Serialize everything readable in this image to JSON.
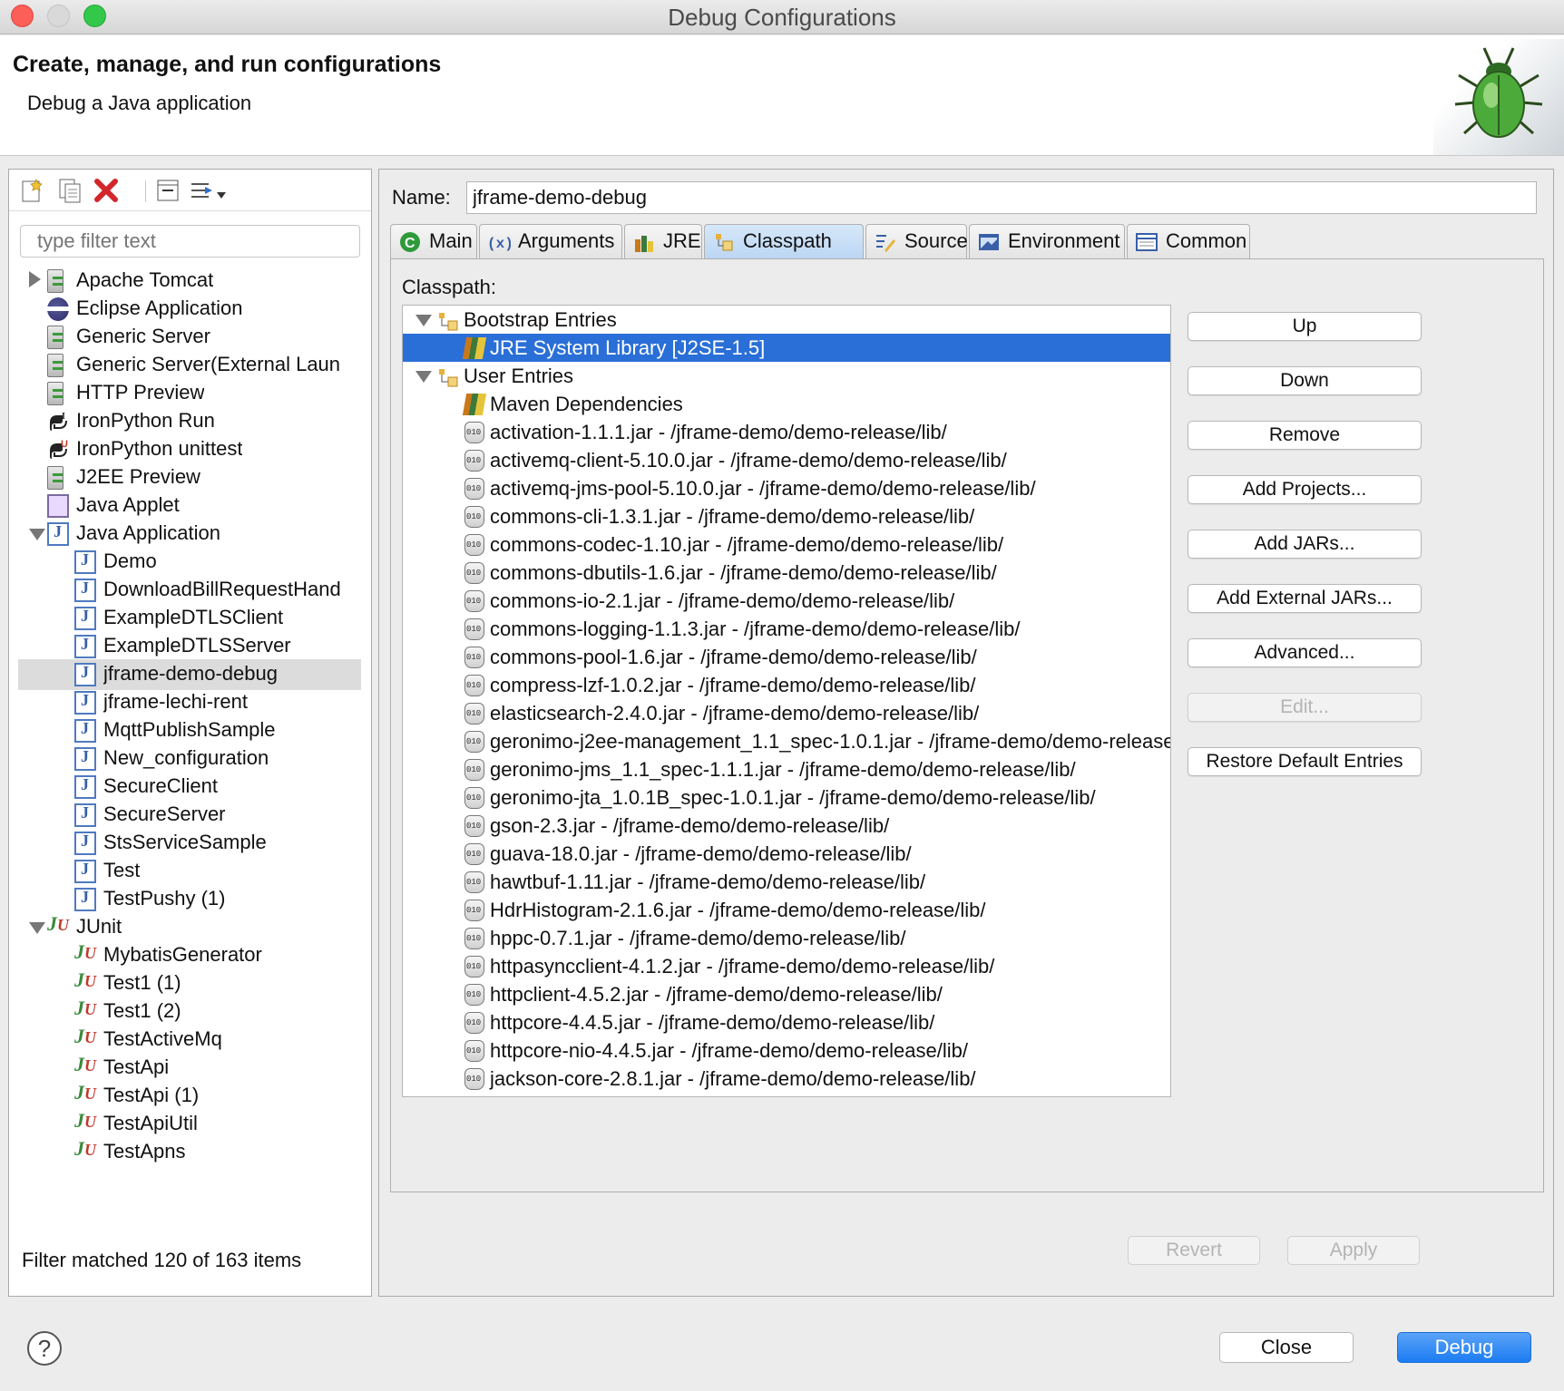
{
  "window": {
    "title": "Debug Configurations"
  },
  "banner": {
    "title": "Create, manage, and run configurations",
    "subtitle": "Debug a Java application"
  },
  "left": {
    "toolbar": {
      "icons": [
        "new-configuration-icon",
        "duplicate-icon",
        "delete-icon",
        "collapse-all-icon",
        "filter-icon",
        "chevron-down-icon"
      ]
    },
    "filter_placeholder": "type filter text",
    "tree": [
      {
        "label": "Apache Tomcat",
        "icon": "server-icon",
        "level": 0,
        "twisty": "closed"
      },
      {
        "label": "Eclipse Application",
        "icon": "eclipse-icon",
        "level": 0,
        "twisty": "none"
      },
      {
        "label": "Generic Server",
        "icon": "server-icon",
        "level": 0,
        "twisty": "none"
      },
      {
        "label": "Generic Server(External Laun",
        "icon": "server-icon",
        "level": 0,
        "twisty": "none"
      },
      {
        "label": "HTTP Preview",
        "icon": "server-icon",
        "level": 0,
        "twisty": "none"
      },
      {
        "label": "IronPython Run",
        "icon": "ironpython-icon",
        "level": 0,
        "twisty": "none"
      },
      {
        "label": "IronPython unittest",
        "icon": "ironpython-unittest-icon",
        "level": 0,
        "twisty": "none"
      },
      {
        "label": "J2EE Preview",
        "icon": "server-icon",
        "level": 0,
        "twisty": "none"
      },
      {
        "label": "Java Applet",
        "icon": "java-applet-icon",
        "level": 0,
        "twisty": "none"
      },
      {
        "label": "Java Application",
        "icon": "java-app-icon",
        "level": 0,
        "twisty": "open"
      },
      {
        "label": "Demo",
        "icon": "java-app-icon",
        "level": 1
      },
      {
        "label": "DownloadBillRequestHand",
        "icon": "java-app-icon",
        "level": 1
      },
      {
        "label": "ExampleDTLSClient",
        "icon": "java-app-icon",
        "level": 1
      },
      {
        "label": "ExampleDTLSServer",
        "icon": "java-app-icon",
        "level": 1
      },
      {
        "label": "jframe-demo-debug",
        "icon": "java-app-icon",
        "level": 1,
        "selected": true
      },
      {
        "label": "jframe-lechi-rent",
        "icon": "java-app-icon",
        "level": 1
      },
      {
        "label": "MqttPublishSample",
        "icon": "java-app-icon",
        "level": 1
      },
      {
        "label": "New_configuration",
        "icon": "java-app-icon",
        "level": 1
      },
      {
        "label": "SecureClient",
        "icon": "java-app-icon",
        "level": 1
      },
      {
        "label": "SecureServer",
        "icon": "java-app-icon",
        "level": 1
      },
      {
        "label": "StsServiceSample",
        "icon": "java-app-icon",
        "level": 1
      },
      {
        "label": "Test",
        "icon": "java-app-icon",
        "level": 1
      },
      {
        "label": "TestPushy (1)",
        "icon": "java-app-icon",
        "level": 1
      },
      {
        "label": "JUnit",
        "icon": "junit-icon",
        "level": 0,
        "twisty": "open"
      },
      {
        "label": "MybatisGenerator",
        "icon": "junit-icon",
        "level": 1
      },
      {
        "label": "Test1 (1)",
        "icon": "junit-icon",
        "level": 1
      },
      {
        "label": "Test1 (2)",
        "icon": "junit-icon",
        "level": 1
      },
      {
        "label": "TestActiveMq",
        "icon": "junit-icon",
        "level": 1
      },
      {
        "label": "TestApi",
        "icon": "junit-icon",
        "level": 1
      },
      {
        "label": "TestApi (1)",
        "icon": "junit-icon",
        "level": 1
      },
      {
        "label": "TestApiUtil",
        "icon": "junit-icon",
        "level": 1
      },
      {
        "label": "TestApns",
        "icon": "junit-icon",
        "level": 1
      }
    ],
    "footer": "Filter matched 120 of 163 items"
  },
  "right": {
    "name_label": "Name:",
    "name_value": "jframe-demo-debug",
    "tabs": [
      {
        "label": "Main",
        "icon": "main-tab-icon"
      },
      {
        "label": "Arguments",
        "icon": "arguments-icon"
      },
      {
        "label": "JRE",
        "icon": "jre-icon"
      },
      {
        "label": "Classpath",
        "icon": "classpath-icon",
        "active": true
      },
      {
        "label": "Source",
        "icon": "source-icon"
      },
      {
        "label": "Environment",
        "icon": "environment-icon"
      },
      {
        "label": "Common",
        "icon": "common-icon"
      }
    ],
    "classpath_label": "Classpath:",
    "classpath": [
      {
        "label": "Bootstrap Entries",
        "type": "group"
      },
      {
        "label": "JRE System Library [J2SE-1.5]",
        "type": "library",
        "selected": true
      },
      {
        "label": "User Entries",
        "type": "group"
      },
      {
        "label": "Maven Dependencies",
        "type": "library"
      },
      {
        "label": "activation-1.1.1.jar - /jframe-demo/demo-release/lib/",
        "type": "jar"
      },
      {
        "label": "activemq-client-5.10.0.jar - /jframe-demo/demo-release/lib/",
        "type": "jar"
      },
      {
        "label": "activemq-jms-pool-5.10.0.jar - /jframe-demo/demo-release/lib/",
        "type": "jar"
      },
      {
        "label": "commons-cli-1.3.1.jar - /jframe-demo/demo-release/lib/",
        "type": "jar"
      },
      {
        "label": "commons-codec-1.10.jar - /jframe-demo/demo-release/lib/",
        "type": "jar"
      },
      {
        "label": "commons-dbutils-1.6.jar - /jframe-demo/demo-release/lib/",
        "type": "jar"
      },
      {
        "label": "commons-io-2.1.jar - /jframe-demo/demo-release/lib/",
        "type": "jar"
      },
      {
        "label": "commons-logging-1.1.3.jar - /jframe-demo/demo-release/lib/",
        "type": "jar"
      },
      {
        "label": "commons-pool-1.6.jar - /jframe-demo/demo-release/lib/",
        "type": "jar"
      },
      {
        "label": "compress-lzf-1.0.2.jar - /jframe-demo/demo-release/lib/",
        "type": "jar"
      },
      {
        "label": "elasticsearch-2.4.0.jar - /jframe-demo/demo-release/lib/",
        "type": "jar"
      },
      {
        "label": "geronimo-j2ee-management_1.1_spec-1.0.1.jar - /jframe-demo/demo-release",
        "type": "jar"
      },
      {
        "label": "geronimo-jms_1.1_spec-1.1.1.jar - /jframe-demo/demo-release/lib/",
        "type": "jar"
      },
      {
        "label": "geronimo-jta_1.0.1B_spec-1.0.1.jar - /jframe-demo/demo-release/lib/",
        "type": "jar"
      },
      {
        "label": "gson-2.3.jar - /jframe-demo/demo-release/lib/",
        "type": "jar"
      },
      {
        "label": "guava-18.0.jar - /jframe-demo/demo-release/lib/",
        "type": "jar"
      },
      {
        "label": "hawtbuf-1.11.jar - /jframe-demo/demo-release/lib/",
        "type": "jar"
      },
      {
        "label": "HdrHistogram-2.1.6.jar - /jframe-demo/demo-release/lib/",
        "type": "jar"
      },
      {
        "label": "hppc-0.7.1.jar - /jframe-demo/demo-release/lib/",
        "type": "jar"
      },
      {
        "label": "httpasyncclient-4.1.2.jar - /jframe-demo/demo-release/lib/",
        "type": "jar"
      },
      {
        "label": "httpclient-4.5.2.jar - /jframe-demo/demo-release/lib/",
        "type": "jar"
      },
      {
        "label": "httpcore-4.4.5.jar - /jframe-demo/demo-release/lib/",
        "type": "jar"
      },
      {
        "label": "httpcore-nio-4.4.5.jar - /jframe-demo/demo-release/lib/",
        "type": "jar"
      },
      {
        "label": "jackson-core-2.8.1.jar - /jframe-demo/demo-release/lib/",
        "type": "jar"
      }
    ],
    "buttons": [
      {
        "label": "Up",
        "enabled": true
      },
      {
        "label": "Down",
        "enabled": true
      },
      {
        "label": "Remove",
        "enabled": true
      },
      {
        "label": "Add Projects...",
        "enabled": true
      },
      {
        "label": "Add JARs...",
        "enabled": true
      },
      {
        "label": "Add External JARs...",
        "enabled": true
      },
      {
        "label": "Advanced...",
        "enabled": true
      },
      {
        "label": "Edit...",
        "enabled": false
      },
      {
        "label": "Restore Default Entries",
        "enabled": true
      }
    ],
    "revert_label": "Revert",
    "apply_label": "Apply"
  },
  "footer": {
    "help_label": "?",
    "close_label": "Close",
    "debug_label": "Debug"
  },
  "colors": {
    "selection": "#2a6fd7",
    "primary_button": "#1c7cf2",
    "junit_j": "#3b8a3b",
    "junit_u": "#c0392b"
  }
}
